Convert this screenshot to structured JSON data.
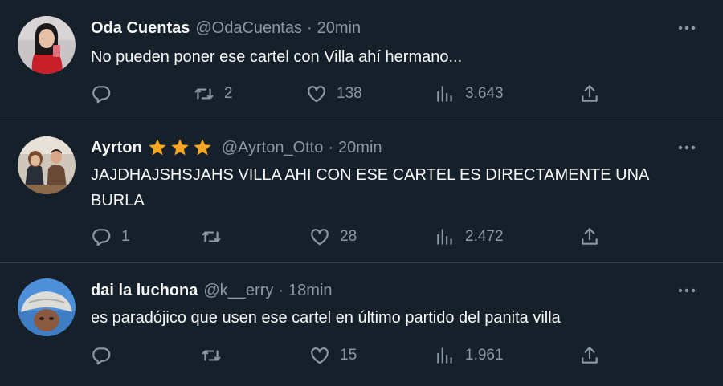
{
  "tweets": [
    {
      "name": "Oda Cuentas",
      "handle": "@OdaCuentas",
      "separator": "·",
      "time": "20min",
      "text": "No pueden poner ese cartel con Villa ahí hermano...",
      "replies": "",
      "retweets": "2",
      "likes": "138",
      "views": "3.643",
      "avatar_icon": "woman-red-jacket-avatar"
    },
    {
      "name": "Ayrton",
      "handle": "@Ayrton_Otto",
      "separator": "·",
      "time": "20min",
      "text": "JAJDHAJSHSJAHS VILLA AHI CON ESE CARTEL ES DIRECTAMENTE UNA BURLA",
      "replies": "1",
      "retweets": "",
      "likes": "28",
      "views": "2.472",
      "stars": 3,
      "star_color": "#f4a523",
      "avatar_icon": "couple-photo-avatar"
    },
    {
      "name": "dai la luchona",
      "handle": "@k__erry",
      "separator": "·",
      "time": "18min",
      "text": "es paradójico que usen ese cartel en último partido del panita villa",
      "replies": "",
      "retweets": "",
      "likes": "15",
      "views": "1.961",
      "avatar_icon": "person-bucket-hat-avatar"
    }
  ],
  "colors": {
    "background": "#15202b",
    "text": "#f7f9f9",
    "secondary": "#8b98a5",
    "divider": "#38444d"
  },
  "icons": [
    "reply-icon",
    "retweet-icon",
    "like-icon",
    "views-icon",
    "share-icon",
    "more-icon"
  ]
}
